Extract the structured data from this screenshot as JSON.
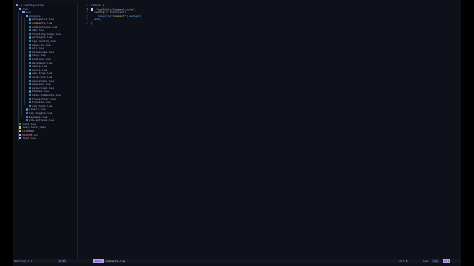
{
  "tree": {
    "root": "~/.config/nvim/",
    "items": [
      {
        "depth": 1,
        "type": "folder",
        "name": "lua"
      },
      {
        "depth": 2,
        "type": "folder",
        "name": "lua"
      },
      {
        "depth": 3,
        "type": "folder",
        "name": "plugins"
      },
      {
        "depth": 4,
        "type": "lua",
        "name": "autopairs.lua"
      },
      {
        "depth": 4,
        "type": "lua",
        "name": "comments.lua",
        "active": true
      },
      {
        "depth": 4,
        "type": "lua",
        "name": "completions.lua"
      },
      {
        "depth": 4,
        "type": "lua",
        "name": "dap.lua"
      },
      {
        "depth": 4,
        "type": "lua",
        "name": "floating-help.lua"
      },
      {
        "depth": 4,
        "type": "lua",
        "name": "gitsigns.lua"
      },
      {
        "depth": 4,
        "type": "lua",
        "name": "lsp-config.lua"
      },
      {
        "depth": 4,
        "type": "lua",
        "name": "none-ls.lua"
      },
      {
        "depth": 4,
        "type": "lua",
        "name": "oil.lua"
      },
      {
        "depth": 4,
        "type": "lua",
        "name": "telescope.lua"
      },
      {
        "depth": 4,
        "type": "lua",
        "name": "lazy.lua"
      },
      {
        "depth": 4,
        "type": "lua",
        "name": "lualine.lua"
      },
      {
        "depth": 4,
        "type": "lua",
        "name": "markdown.lua"
      },
      {
        "depth": 4,
        "type": "lua",
        "name": "neorg.lua"
      },
      {
        "depth": 4,
        "type": "lua",
        "name": "noice.lua"
      },
      {
        "depth": 4,
        "type": "lua",
        "name": "neo-tree.lua"
      },
      {
        "depth": 4,
        "type": "lua",
        "name": "nvim-ufo.lua"
      },
      {
        "depth": 4,
        "type": "lua",
        "name": "oxocarbon.lua"
      },
      {
        "depth": 4,
        "type": "lua",
        "name": "session.lua"
      },
      {
        "depth": 4,
        "type": "lua",
        "name": "solarized.lua"
      },
      {
        "depth": 4,
        "type": "lua",
        "name": "themes.lua"
      },
      {
        "depth": 4,
        "type": "lua",
        "name": "todo-comments.lua"
      },
      {
        "depth": 4,
        "type": "lua",
        "name": "treesitter.lua"
      },
      {
        "depth": 4,
        "type": "lua",
        "name": "trouble.lua"
      },
      {
        "depth": 4,
        "type": "lua",
        "name": "vim-test.lua"
      },
      {
        "depth": 3,
        "type": "lua",
        "name": "(user).lua"
      },
      {
        "depth": 3,
        "type": "lua",
        "name": "lsp-toggle.lua"
      },
      {
        "depth": 3,
        "type": "lua",
        "name": "keymaps.lua"
      },
      {
        "depth": 3,
        "type": "lua",
        "name": "vim-options.lua"
      },
      {
        "depth": 1,
        "type": "lua",
        "name": "init.lua"
      },
      {
        "depth": 1,
        "type": "json",
        "name": "lazy-lock.json"
      },
      {
        "depth": 1,
        "type": "lic",
        "name": "LICENSE"
      },
      {
        "depth": 1,
        "type": "md",
        "name": "README.md",
        "git": true
      },
      {
        "depth": 1,
        "type": "md",
        "name": "test.lua"
      }
    ]
  },
  "editor": {
    "lines": [
      {
        "n": "1",
        "tokens": [
          {
            "c": "kw",
            "t": "return"
          },
          {
            "c": "pn",
            "t": " {"
          }
        ]
      },
      {
        "n": "2",
        "cursor": true,
        "tokens": [
          {
            "c": "pn",
            "t": "  "
          },
          {
            "c": "str",
            "t": "\"numToStr/Comment.nvim\""
          },
          {
            "c": "pn",
            "t": ","
          }
        ]
      },
      {
        "n": "3",
        "tokens": [
          {
            "c": "id",
            "t": "  config"
          },
          {
            "c": "pn",
            "t": " = "
          },
          {
            "c": "kw",
            "t": "function"
          },
          {
            "c": "pn",
            "t": "()"
          }
        ]
      },
      {
        "n": "4",
        "tokens": [
          {
            "c": "fn",
            "t": "    require"
          },
          {
            "c": "pn",
            "t": "("
          },
          {
            "c": "str",
            "t": "\"Comment\""
          },
          {
            "c": "pn",
            "t": ")."
          },
          {
            "c": "fn",
            "t": "setup"
          },
          {
            "c": "pn",
            "t": "()"
          }
        ]
      },
      {
        "n": "5",
        "tokens": [
          {
            "c": "kw",
            "t": "  end"
          },
          {
            "c": "pn",
            "t": ","
          }
        ]
      },
      {
        "n": "6",
        "tokens": [
          {
            "c": "pn",
            "t": "}"
          }
        ]
      }
    ]
  },
  "status": {
    "left_path": "Ndafrom_1 1",
    "mode": "N NT",
    "branch": "main",
    "file": "comments.lua",
    "encoding": "utf-8",
    "filetype": "lua",
    "percent": "Top",
    "position": "2:1"
  }
}
